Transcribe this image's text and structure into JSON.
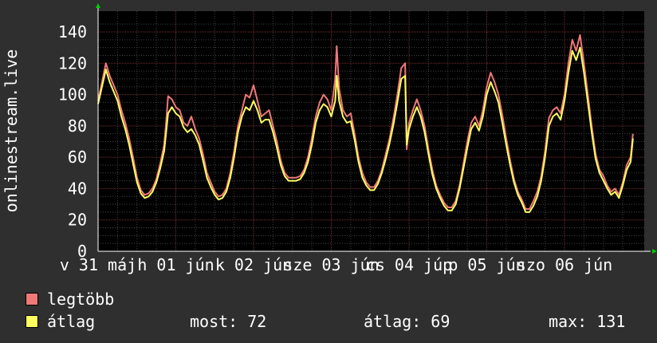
{
  "chart_data": {
    "type": "line",
    "ylabel": "onlinestream.live",
    "ylim": [
      0,
      145
    ],
    "yticks": [
      0,
      20,
      40,
      60,
      80,
      100,
      120,
      140
    ],
    "xlim": [
      0,
      7.2
    ],
    "x_tick_labels": [
      {
        "at": 0,
        "label": "v 31 máj"
      },
      {
        "at": 1,
        "label": "h 01 jún"
      },
      {
        "at": 2,
        "label": "k 02 jún"
      },
      {
        "at": 3,
        "label": "sze 03 jún"
      },
      {
        "at": 4,
        "label": "cs 04 júp"
      },
      {
        "at": 5,
        "label": "p 05 jún"
      },
      {
        "at": 6,
        "label": "szo 06 jún"
      }
    ],
    "grid": true,
    "colors": {
      "max": "#f07878",
      "avg": "#ffff60",
      "background": "#2f2f2f",
      "plot": "#000000",
      "axis": "#ffffff",
      "grid": "#707070",
      "arrow": "#00cc00"
    },
    "series": [
      {
        "name": "legtöbb",
        "color": "#f07878",
        "points": [
          [
            0,
            96
          ],
          [
            0.05,
            108
          ],
          [
            0.1,
            120
          ],
          [
            0.15,
            112
          ],
          [
            0.2,
            106
          ],
          [
            0.25,
            100
          ],
          [
            0.3,
            90
          ],
          [
            0.35,
            82
          ],
          [
            0.4,
            72
          ],
          [
            0.45,
            60
          ],
          [
            0.5,
            47
          ],
          [
            0.55,
            39
          ],
          [
            0.6,
            36
          ],
          [
            0.65,
            37
          ],
          [
            0.7,
            40
          ],
          [
            0.75,
            46
          ],
          [
            0.8,
            56
          ],
          [
            0.85,
            68
          ],
          [
            0.88,
            85
          ],
          [
            0.9,
            99
          ],
          [
            0.95,
            97
          ],
          [
            1.0,
            92
          ],
          [
            1.05,
            90
          ],
          [
            1.1,
            82
          ],
          [
            1.15,
            80
          ],
          [
            1.2,
            86
          ],
          [
            1.25,
            78
          ],
          [
            1.3,
            72
          ],
          [
            1.35,
            62
          ],
          [
            1.4,
            50
          ],
          [
            1.45,
            44
          ],
          [
            1.5,
            38
          ],
          [
            1.55,
            35
          ],
          [
            1.6,
            36
          ],
          [
            1.65,
            40
          ],
          [
            1.7,
            50
          ],
          [
            1.75,
            64
          ],
          [
            1.8,
            80
          ],
          [
            1.85,
            90
          ],
          [
            1.9,
            100
          ],
          [
            1.95,
            98
          ],
          [
            2.0,
            106
          ],
          [
            2.05,
            96
          ],
          [
            2.1,
            86
          ],
          [
            2.15,
            88
          ],
          [
            2.2,
            90
          ],
          [
            2.25,
            80
          ],
          [
            2.3,
            70
          ],
          [
            2.35,
            58
          ],
          [
            2.4,
            50
          ],
          [
            2.45,
            47
          ],
          [
            2.5,
            47
          ],
          [
            2.55,
            47
          ],
          [
            2.6,
            48
          ],
          [
            2.65,
            52
          ],
          [
            2.7,
            60
          ],
          [
            2.75,
            72
          ],
          [
            2.8,
            86
          ],
          [
            2.85,
            95
          ],
          [
            2.9,
            100
          ],
          [
            2.95,
            97
          ],
          [
            3.0,
            90
          ],
          [
            3.05,
            110
          ],
          [
            3.07,
            131
          ],
          [
            3.1,
            104
          ],
          [
            3.15,
            90
          ],
          [
            3.2,
            86
          ],
          [
            3.25,
            88
          ],
          [
            3.3,
            75
          ],
          [
            3.35,
            60
          ],
          [
            3.4,
            50
          ],
          [
            3.45,
            44
          ],
          [
            3.5,
            41
          ],
          [
            3.55,
            41
          ],
          [
            3.6,
            45
          ],
          [
            3.65,
            52
          ],
          [
            3.7,
            62
          ],
          [
            3.75,
            72
          ],
          [
            3.8,
            85
          ],
          [
            3.85,
            100
          ],
          [
            3.9,
            117
          ],
          [
            3.95,
            120
          ],
          [
            3.97,
            65
          ],
          [
            4.0,
            82
          ],
          [
            4.05,
            90
          ],
          [
            4.1,
            97
          ],
          [
            4.15,
            90
          ],
          [
            4.2,
            80
          ],
          [
            4.25,
            65
          ],
          [
            4.3,
            52
          ],
          [
            4.35,
            42
          ],
          [
            4.4,
            36
          ],
          [
            4.45,
            31
          ],
          [
            4.5,
            28
          ],
          [
            4.55,
            28
          ],
          [
            4.6,
            32
          ],
          [
            4.65,
            42
          ],
          [
            4.7,
            56
          ],
          [
            4.75,
            70
          ],
          [
            4.8,
            82
          ],
          [
            4.85,
            86
          ],
          [
            4.9,
            80
          ],
          [
            4.95,
            90
          ],
          [
            5.0,
            105
          ],
          [
            5.05,
            114
          ],
          [
            5.1,
            108
          ],
          [
            5.15,
            100
          ],
          [
            5.2,
            87
          ],
          [
            5.25,
            72
          ],
          [
            5.3,
            58
          ],
          [
            5.35,
            46
          ],
          [
            5.4,
            38
          ],
          [
            5.45,
            33
          ],
          [
            5.5,
            27
          ],
          [
            5.55,
            27
          ],
          [
            5.6,
            32
          ],
          [
            5.65,
            38
          ],
          [
            5.7,
            48
          ],
          [
            5.75,
            64
          ],
          [
            5.8,
            85
          ],
          [
            5.85,
            90
          ],
          [
            5.9,
            92
          ],
          [
            5.95,
            88
          ],
          [
            6.0,
            100
          ],
          [
            6.05,
            120
          ],
          [
            6.1,
            135
          ],
          [
            6.15,
            128
          ],
          [
            6.2,
            138
          ],
          [
            6.25,
            120
          ],
          [
            6.3,
            100
          ],
          [
            6.35,
            80
          ],
          [
            6.4,
            62
          ],
          [
            6.45,
            52
          ],
          [
            6.5,
            48
          ],
          [
            6.55,
            42
          ],
          [
            6.6,
            38
          ],
          [
            6.65,
            40
          ],
          [
            6.7,
            36
          ],
          [
            6.75,
            44
          ],
          [
            6.8,
            55
          ],
          [
            6.85,
            60
          ],
          [
            6.88,
            75
          ]
        ]
      },
      {
        "name": "átlag",
        "color": "#ffff60",
        "points": [
          [
            0,
            94
          ],
          [
            0.05,
            105
          ],
          [
            0.1,
            116
          ],
          [
            0.15,
            108
          ],
          [
            0.2,
            102
          ],
          [
            0.25,
            96
          ],
          [
            0.3,
            86
          ],
          [
            0.35,
            78
          ],
          [
            0.4,
            68
          ],
          [
            0.45,
            56
          ],
          [
            0.5,
            44
          ],
          [
            0.55,
            37
          ],
          [
            0.6,
            34
          ],
          [
            0.65,
            35
          ],
          [
            0.7,
            38
          ],
          [
            0.75,
            44
          ],
          [
            0.8,
            53
          ],
          [
            0.85,
            64
          ],
          [
            0.88,
            78
          ],
          [
            0.9,
            88
          ],
          [
            0.95,
            92
          ],
          [
            1.0,
            88
          ],
          [
            1.05,
            86
          ],
          [
            1.1,
            79
          ],
          [
            1.15,
            76
          ],
          [
            1.2,
            78
          ],
          [
            1.25,
            74
          ],
          [
            1.3,
            68
          ],
          [
            1.35,
            58
          ],
          [
            1.4,
            47
          ],
          [
            1.45,
            41
          ],
          [
            1.5,
            36
          ],
          [
            1.55,
            33
          ],
          [
            1.6,
            34
          ],
          [
            1.65,
            38
          ],
          [
            1.7,
            47
          ],
          [
            1.75,
            60
          ],
          [
            1.8,
            76
          ],
          [
            1.85,
            86
          ],
          [
            1.9,
            92
          ],
          [
            1.95,
            90
          ],
          [
            2.0,
            96
          ],
          [
            2.05,
            90
          ],
          [
            2.1,
            82
          ],
          [
            2.15,
            84
          ],
          [
            2.2,
            84
          ],
          [
            2.25,
            76
          ],
          [
            2.3,
            66
          ],
          [
            2.35,
            55
          ],
          [
            2.4,
            48
          ],
          [
            2.45,
            45
          ],
          [
            2.5,
            45
          ],
          [
            2.55,
            45
          ],
          [
            2.6,
            46
          ],
          [
            2.65,
            50
          ],
          [
            2.7,
            57
          ],
          [
            2.75,
            68
          ],
          [
            2.8,
            82
          ],
          [
            2.85,
            90
          ],
          [
            2.9,
            94
          ],
          [
            2.95,
            92
          ],
          [
            3.0,
            86
          ],
          [
            3.05,
            96
          ],
          [
            3.07,
            112
          ],
          [
            3.1,
            96
          ],
          [
            3.15,
            86
          ],
          [
            3.2,
            82
          ],
          [
            3.25,
            83
          ],
          [
            3.3,
            71
          ],
          [
            3.35,
            57
          ],
          [
            3.4,
            47
          ],
          [
            3.45,
            42
          ],
          [
            3.5,
            39
          ],
          [
            3.55,
            39
          ],
          [
            3.6,
            43
          ],
          [
            3.65,
            50
          ],
          [
            3.7,
            59
          ],
          [
            3.75,
            69
          ],
          [
            3.8,
            81
          ],
          [
            3.85,
            95
          ],
          [
            3.9,
            110
          ],
          [
            3.95,
            112
          ],
          [
            3.97,
            68
          ],
          [
            4.0,
            78
          ],
          [
            4.05,
            86
          ],
          [
            4.1,
            92
          ],
          [
            4.15,
            86
          ],
          [
            4.2,
            76
          ],
          [
            4.25,
            62
          ],
          [
            4.3,
            49
          ],
          [
            4.35,
            40
          ],
          [
            4.4,
            34
          ],
          [
            4.45,
            29
          ],
          [
            4.5,
            26
          ],
          [
            4.55,
            26
          ],
          [
            4.6,
            30
          ],
          [
            4.65,
            40
          ],
          [
            4.7,
            53
          ],
          [
            4.75,
            66
          ],
          [
            4.8,
            78
          ],
          [
            4.85,
            82
          ],
          [
            4.9,
            77
          ],
          [
            4.95,
            86
          ],
          [
            5.0,
            100
          ],
          [
            5.05,
            108
          ],
          [
            5.1,
            102
          ],
          [
            5.15,
            95
          ],
          [
            5.2,
            82
          ],
          [
            5.25,
            68
          ],
          [
            5.3,
            55
          ],
          [
            5.35,
            44
          ],
          [
            5.4,
            36
          ],
          [
            5.45,
            31
          ],
          [
            5.5,
            25
          ],
          [
            5.55,
            25
          ],
          [
            5.6,
            29
          ],
          [
            5.65,
            35
          ],
          [
            5.7,
            45
          ],
          [
            5.75,
            60
          ],
          [
            5.8,
            80
          ],
          [
            5.85,
            86
          ],
          [
            5.9,
            88
          ],
          [
            5.95,
            84
          ],
          [
            6.0,
            96
          ],
          [
            6.05,
            114
          ],
          [
            6.1,
            128
          ],
          [
            6.15,
            122
          ],
          [
            6.2,
            130
          ],
          [
            6.25,
            114
          ],
          [
            6.3,
            95
          ],
          [
            6.35,
            76
          ],
          [
            6.4,
            59
          ],
          [
            6.45,
            50
          ],
          [
            6.5,
            45
          ],
          [
            6.55,
            40
          ],
          [
            6.6,
            36
          ],
          [
            6.65,
            38
          ],
          [
            6.7,
            34
          ],
          [
            6.75,
            42
          ],
          [
            6.8,
            52
          ],
          [
            6.85,
            57
          ],
          [
            6.88,
            72
          ]
        ]
      }
    ]
  },
  "legend": {
    "max_label": "legtöbb",
    "avg_label": "átlag"
  },
  "stats": {
    "now": "most: 72",
    "avg": "átlag: 69",
    "max": "max: 131"
  }
}
